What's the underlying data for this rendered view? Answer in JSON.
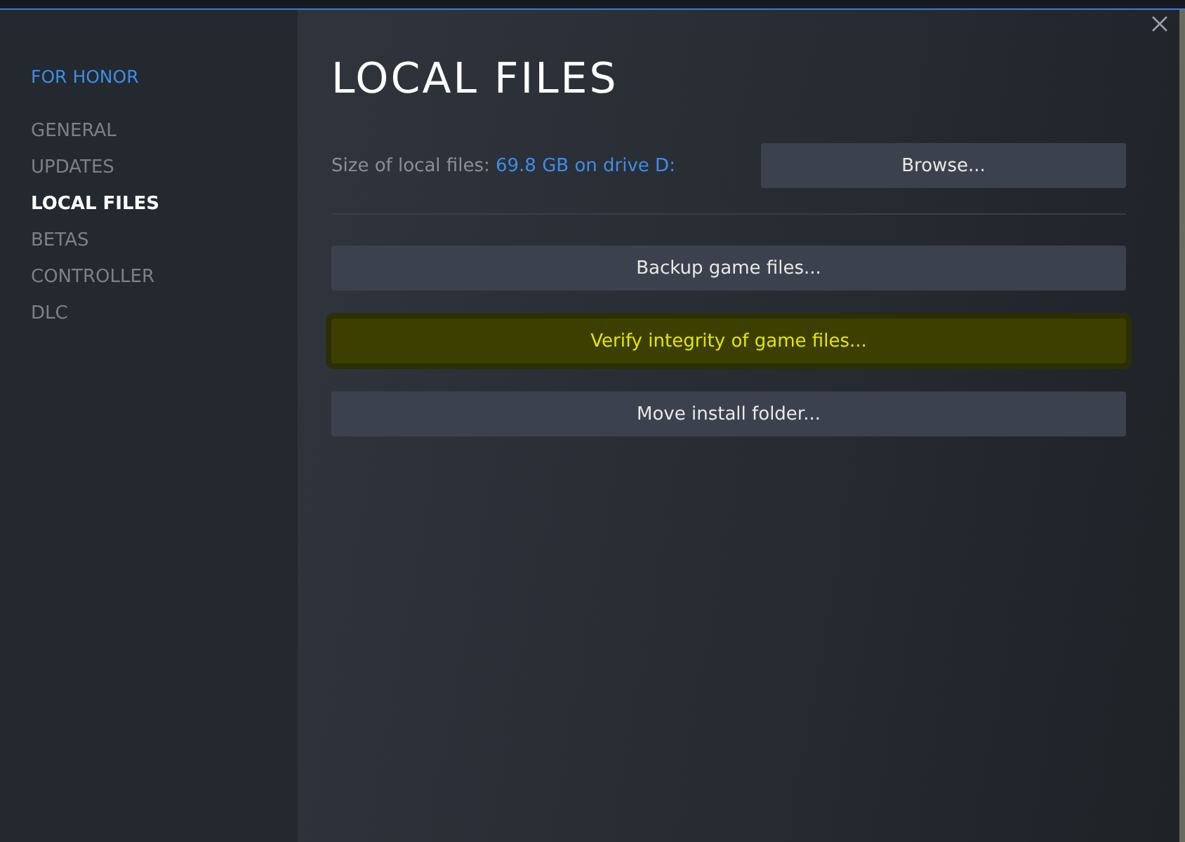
{
  "sidebar": {
    "game_title": "FOR HONOR",
    "items": [
      {
        "label": "GENERAL",
        "selected": false
      },
      {
        "label": "UPDATES",
        "selected": false
      },
      {
        "label": "LOCAL FILES",
        "selected": true
      },
      {
        "label": "BETAS",
        "selected": false
      },
      {
        "label": "CONTROLLER",
        "selected": false
      },
      {
        "label": "DLC",
        "selected": false
      }
    ]
  },
  "content": {
    "title": "LOCAL FILES",
    "size_label": "Size of local files:",
    "size_value": "69.8 GB on drive D:",
    "browse_button": "Browse...",
    "actions": [
      {
        "label": "Backup game files...",
        "highlighted": false
      },
      {
        "label": "Verify integrity of game files...",
        "highlighted": true
      },
      {
        "label": "Move install folder...",
        "highlighted": false
      }
    ]
  }
}
